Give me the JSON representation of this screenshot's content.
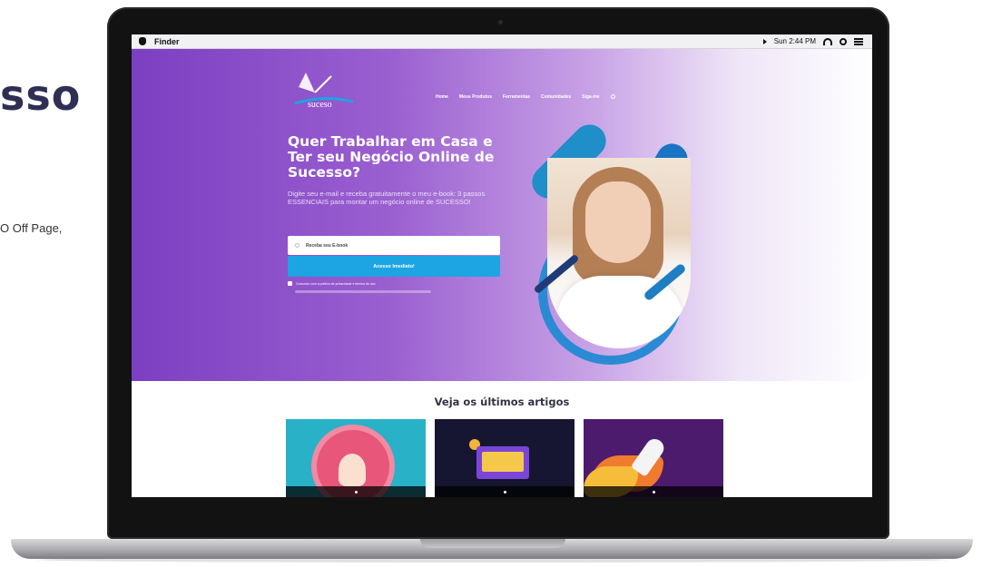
{
  "background_page": {
    "heading_fragment": "sso",
    "text_fragment": "O Off Page,"
  },
  "menubar": {
    "app": "Finder",
    "clock": "Sun 2:44 PM"
  },
  "site": {
    "nav": [
      "Home",
      "Meus Produtos",
      "Ferramentas",
      "Comunidades",
      "Siga-me"
    ],
    "hero": {
      "headline": "Quer Trabalhar em Casa e Ter seu Negócio Online de Sucesso?",
      "subtext": "Digite seu e-mail e receba gratuitamente o meu e-book: 3 passos ESSENCIAIS para montar um negócio online de SUCESSO!",
      "email_placeholder": "Receba seu E-book",
      "cta_label": "Acesso Imediato!",
      "consent": "Concordo com a política de privacidade e termos de uso"
    },
    "articles": {
      "title": "Veja os últimos artigos"
    }
  },
  "colors": {
    "hero_gradient_start": "#7c3fc2",
    "cta": "#1da4e2",
    "heading_dark": "#2f2f55"
  }
}
